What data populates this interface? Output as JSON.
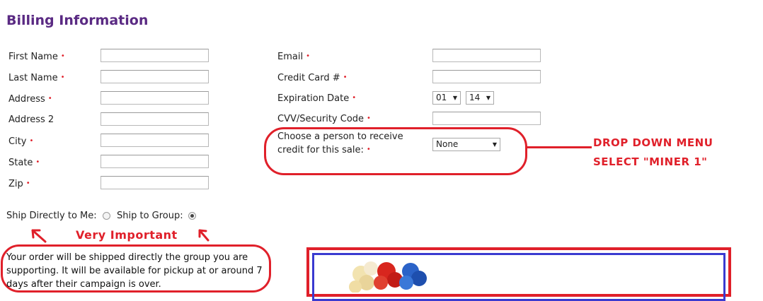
{
  "page": {
    "title": "Billing Information"
  },
  "left_fields": [
    {
      "label": "First Name",
      "required": true,
      "value": ""
    },
    {
      "label": "Last Name",
      "required": true,
      "value": ""
    },
    {
      "label": "Address",
      "required": true,
      "value": ""
    },
    {
      "label": "Address 2",
      "required": false,
      "value": ""
    },
    {
      "label": "City",
      "required": true,
      "value": ""
    },
    {
      "label": "State",
      "required": true,
      "value": ""
    },
    {
      "label": "Zip",
      "required": true,
      "value": ""
    }
  ],
  "right_fields": {
    "email": {
      "label": "Email",
      "value": ""
    },
    "credit_card": {
      "label": "Credit Card #",
      "value": ""
    },
    "expiration": {
      "label": "Expiration Date",
      "month": "01",
      "year": "14"
    },
    "cvv": {
      "label": "CVV/Security Code",
      "value": ""
    },
    "credit_person": {
      "label_line1": "Choose a person to receive",
      "label_line2": "credit for this sale:",
      "selected": "None"
    }
  },
  "required_marker": "•",
  "shipping": {
    "direct_label": "Ship Directly to Me:",
    "group_label": "Ship to Group:",
    "selected": "group"
  },
  "annotations": {
    "dropdown_line1": "DROP DOWN MENU",
    "dropdown_line2": "SELECT \"MINER 1\"",
    "important": "Very Important"
  },
  "notice": "Your order will be shipped directly the group you are supporting. It will be available for pickup at or around 7 days after their campaign is over.",
  "colors": {
    "title": "#5a2a83",
    "required": "#e0202a",
    "annotation": "#e0202a",
    "frame_blue": "#3a3ad0"
  }
}
